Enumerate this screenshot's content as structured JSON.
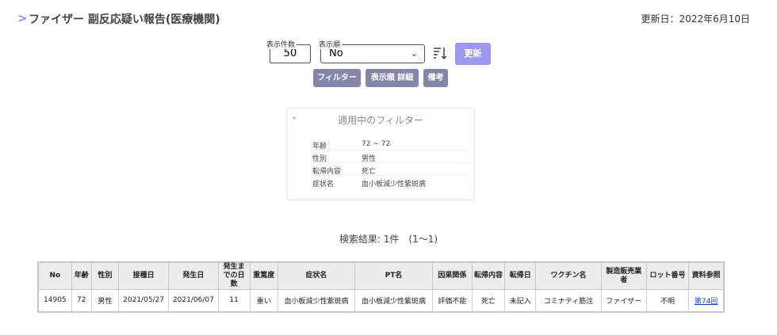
{
  "header": {
    "chevron": ">",
    "title": "ファイザー 副反応疑い報告(医療機関)",
    "updated": "更新日：2022年6月10日"
  },
  "controls": {
    "count_label": "表示件数",
    "count_value": "50",
    "order_label": "表示順",
    "order_value": "No",
    "update_label": "更新",
    "filter_label": "フィルター",
    "order_detail_label": "表示順 詳細",
    "notes_label": "備考"
  },
  "filter_panel": {
    "title": "適用中のフィルター",
    "rows": [
      {
        "key": "年齢",
        "value": "72 ~ 72"
      },
      {
        "key": "性別",
        "value": "男性"
      },
      {
        "key": "転帰内容",
        "value": "死亡"
      },
      {
        "key": "症状名",
        "value": "血小板減少性紫斑病"
      }
    ]
  },
  "results": {
    "summary": "検索結果: 1件　(1〜1)",
    "columns": [
      "No",
      "年齢",
      "性別",
      "接種日",
      "発生日",
      "発生までの日数",
      "重篤度",
      "症状名",
      "PT名",
      "因果関係",
      "転帰内容",
      "転帰日",
      "ワクチン名",
      "製造販売業者",
      "ロット番号",
      "資料参照"
    ],
    "rows": [
      {
        "no": "14905",
        "age": "72",
        "sex": "男性",
        "vaccination_date": "2021/05/27",
        "onset_date": "2021/06/07",
        "days": "11",
        "severity": "重い",
        "symptom": "血小板減少性紫斑病",
        "pt": "血小板減少性紫斑病",
        "causality": "評価不能",
        "outcome": "死亡",
        "outcome_date": "未記入",
        "vaccine": "コミナティ筋注",
        "manufacturer": "ファイザー",
        "lot": "不明",
        "reference": "第74回"
      }
    ]
  },
  "colors": {
    "accent": "#9d98f0",
    "sub_button": "#8386a8",
    "alert_red": "#e03030",
    "male_text": "#5a49d6",
    "link_blue": "#1a3fd0"
  }
}
